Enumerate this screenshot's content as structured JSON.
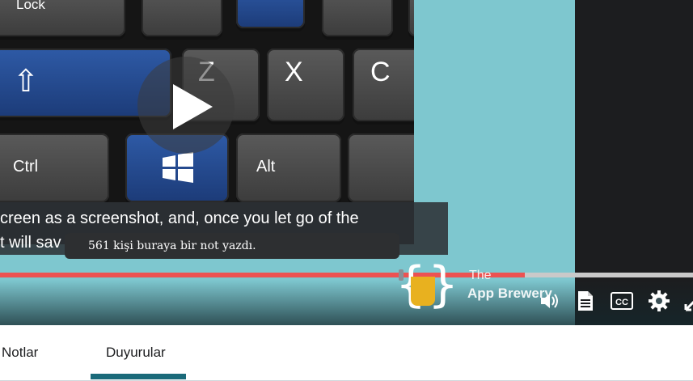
{
  "keyboard": {
    "keys": {
      "lock": "Lock",
      "shift": "⇧",
      "z": "Z",
      "x": "X",
      "c": "C",
      "ctrl": "Ctrl",
      "alt": "Alt"
    }
  },
  "subtitle": {
    "line1": "creen as a screenshot, and, once you let go of the",
    "line2": "t will sav"
  },
  "tooltip": {
    "text": "561 kişi buraya bir not yazdı."
  },
  "progress": {
    "played_fraction": 0.757,
    "played_color": "#ec5252",
    "track_color": "#c9c9c9"
  },
  "watermark": {
    "the": "The",
    "brand": "App Brewery"
  },
  "controls": {
    "icons": [
      "volume-icon",
      "transcript-icon",
      "captions-icon",
      "settings-icon",
      "expand-icon"
    ],
    "cc_label": "CC"
  },
  "tabs": [
    {
      "label": "Notlar",
      "active": false
    },
    {
      "label": "Duyurular",
      "active": true
    }
  ],
  "colors": {
    "accent": "#1a6a7a",
    "player_bg": "#7ec7cf",
    "dark_panel": "#1c1d1f"
  }
}
